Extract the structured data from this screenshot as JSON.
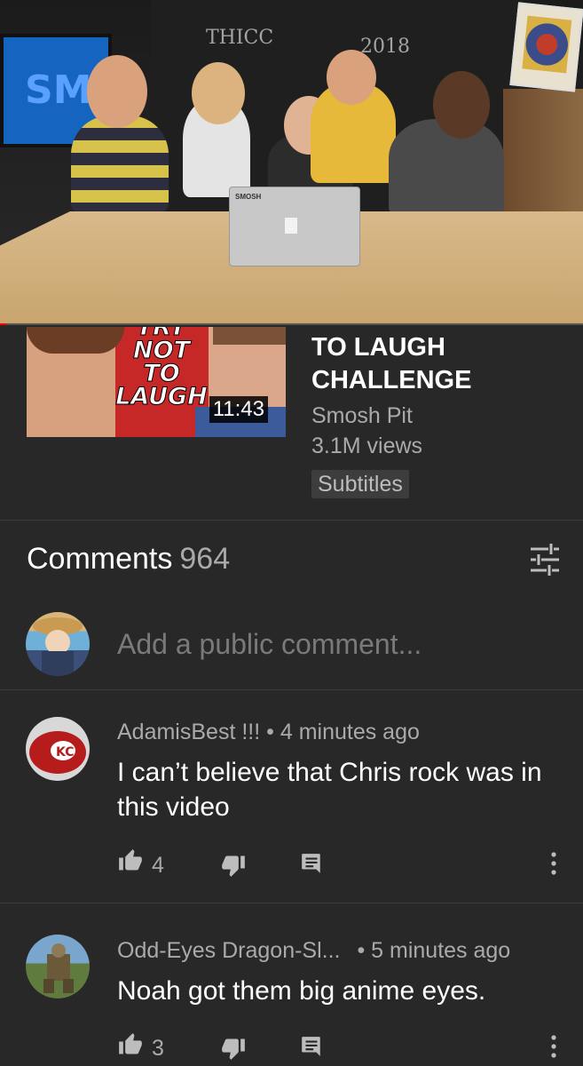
{
  "player": {
    "board_text": [
      "THICC",
      "2018"
    ],
    "tv_text": "SMO",
    "laptop_label": "SMOSH",
    "progress_percent": 1
  },
  "video": {
    "thumbnail_text": "TRY\nNOT\nTO\nLAUGH",
    "duration": "11:43",
    "title": "TO LAUGH\nCHALLENGE",
    "channel": "Smosh Pit",
    "views": "3.1M views",
    "badge": "Subtitles"
  },
  "comments": {
    "label": "Comments",
    "count": "964",
    "add_placeholder": "Add a public comment...",
    "items": [
      {
        "author": "AdamisBest !!!",
        "separator": "•",
        "time": "4 minutes ago",
        "text": "I can’t believe that Chris rock was in this video",
        "likes": "4"
      },
      {
        "author": "Odd-Eyes Dragon-Sl...",
        "separator": "•",
        "time": "5 minutes ago",
        "text": "Noah got them big anime eyes.",
        "likes": "3"
      }
    ]
  },
  "icons": {
    "sort": "sort-filter-icon",
    "like": "thumb-up-icon",
    "dislike": "thumb-down-icon",
    "reply": "reply-comment-icon",
    "more": "more-vertical-icon"
  },
  "colors": {
    "background": "#282828",
    "text_primary": "#ffffff",
    "text_secondary": "#aaaaaa",
    "progress": "#ff0000"
  }
}
